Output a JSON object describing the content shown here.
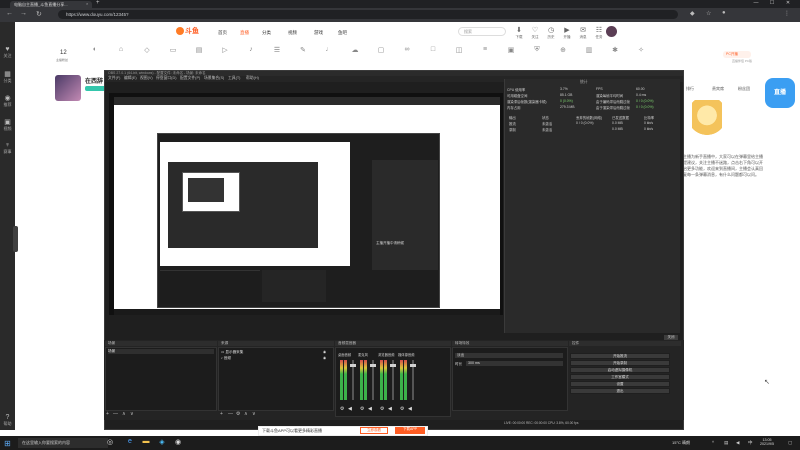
{
  "browser": {
    "tab_title": "电脑自主直播_斗鱼直播分享...",
    "close_glyph": "×",
    "new_tab_glyph": "+",
    "url": "https://www.douyu.com/12345?",
    "window_controls": [
      "—",
      "☐",
      "✕"
    ]
  },
  "site": {
    "logo_text": "斗鱼",
    "nav": [
      "首页",
      "直播",
      "分类",
      "视频",
      "游戏",
      "鱼吧"
    ],
    "search_placeholder": "搜索",
    "top_icons": [
      "下载",
      "关注",
      "历史",
      "开播",
      "消息",
      "鱼吧",
      "任务"
    ],
    "follow_count": "12",
    "follow_label": "主播粉丝",
    "pc_badge": "PC开播",
    "pc_badge_sub": "直播伴侣 PC版",
    "streamer_name": "在西辞",
    "right_tabs": [
      "排行",
      "贵宾席",
      "粉丝团"
    ],
    "right_text": "主播为新手直播中，大家可以在弹幕里给主播提建议，关注主播不迷路，点击右下角可以开启更多功能，欢迎来到直播间，主播会认真回复每一条弹幕消息，有什么问题都可以问。",
    "blue_mascot": "直播",
    "banner_text": "下载斗鱼APP可以看更多精彩直播",
    "banner_btn1": "立即观看",
    "banner_btn2": "下载APP"
  },
  "sidebar": {
    "items": [
      {
        "icon": "♥",
        "label": "关注"
      },
      {
        "icon": "▦",
        "label": "分类"
      },
      {
        "icon": "◉",
        "label": "推荐"
      },
      {
        "icon": "▣",
        "label": "视频"
      },
      {
        "icon": "♆",
        "label": "赛事"
      },
      {
        "icon": "?",
        "label": "帮助"
      },
      {
        "icon": "⚙",
        "label": "设置"
      }
    ]
  },
  "obs": {
    "title": "OBS 27.0.1 (64-bit, windows) - 配置文件: 未命名 - 场景: 未命名",
    "menu": [
      "文件(F)",
      "编辑(E)",
      "视图(V)",
      "停靠窗口(D)",
      "配置文件(P)",
      "场景集合(S)",
      "工具(T)",
      "帮助(H)"
    ],
    "preview_label": "主播开播中请稍候",
    "stats": {
      "title": "统计",
      "rows_left": [
        {
          "k": "CPU 使用率",
          "v": "3.7%"
        },
        {
          "k": "可用磁盘空间",
          "v": "85.1 GB"
        },
        {
          "k": "渲染滞后帧数(渲染器卡顿)",
          "v": "0 (0.0%)"
        },
        {
          "k": "内存占用",
          "v": "279.3 MB"
        }
      ],
      "rows_right": [
        {
          "k": "FPS",
          "v": "60.00"
        },
        {
          "k": "渲染每帧平均时间",
          "v": "0.4 ms"
        },
        {
          "k": "由于编码滞后而跳过帧",
          "v": "0 / 0 (0.0%)"
        },
        {
          "k": "由于渲染滞后而跳过帧",
          "v": "0 / 0 (0.0%)"
        }
      ],
      "table_header": [
        "输出",
        "状态",
        "丢弃的帧数(网络)",
        "已发送数据",
        "比特率"
      ],
      "table_rows": [
        [
          "推流",
          "未激活",
          "0 / 0 (0.0%)",
          "0.0 MB",
          "0 kb/s"
        ],
        [
          "录制",
          "未激活",
          "",
          "0.0 MB",
          "0 kb/s"
        ]
      ],
      "reset_button": "重置",
      "close_button": "关闭"
    },
    "docks": {
      "scenes_title": "场景",
      "scenes": [
        "场景"
      ],
      "sources_title": "来源",
      "sources": [
        "显示器采集",
        "音频"
      ],
      "mixer_title": "音频混音器",
      "mixer_channels": [
        "桌面音频",
        "麦克风",
        "浏览器音频",
        "媒体源音频"
      ],
      "transitions_title": "转场特效",
      "transition_value": "淡出",
      "duration_label": "时长",
      "duration_value": "300 ms",
      "controls_title": "控件",
      "controls": [
        "开始推流",
        "开始录制",
        "启动虚拟摄像机",
        "工作室模式",
        "设置",
        "退出"
      ],
      "foot_add": "+",
      "foot_remove": "—",
      "foot_up": "∧",
      "foot_down": "∨",
      "foot_gear": "⚙"
    },
    "status": "LIVE: 00:00:00   REC: 00:00:00   CPU: 3.8%, 60.00 fps"
  },
  "taskbar": {
    "search_placeholder": "在这里输入你要搜索的内容",
    "weather": "15°C 晴朗",
    "time": "13:05",
    "date": "2021/9/5"
  },
  "colors": {
    "accent": "#ff5d23",
    "obs_bg": "#1f1f1f",
    "meter_green": "#3cb24a"
  }
}
